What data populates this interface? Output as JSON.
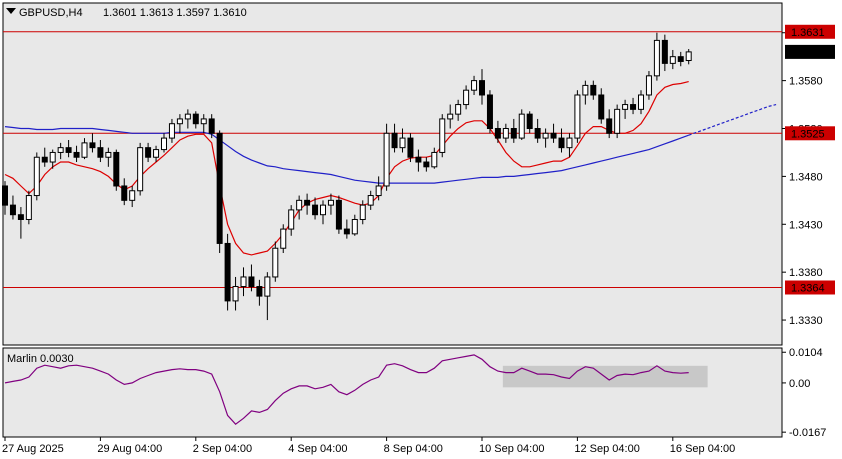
{
  "colors": {
    "panel_bg": "#e8e8e8",
    "axis_bg": "#ffffff",
    "bull_candle": "#ffffff",
    "bear_candle": "#000000",
    "fast_ma": "#dd0000",
    "slow_ma": "#2020c8",
    "level_line": "#cc0000",
    "marlin_line": "#800080",
    "marlin_zone": "#c8c8c8"
  },
  "icons": {
    "collapse": "triangle-down-icon"
  },
  "chart_data": [
    {
      "type": "candlestick",
      "title": "GBPUSD,H4",
      "ohlc_header": "1.3601 1.3613 1.3597 1.3610",
      "ylim": [
        1.3305,
        1.366
      ],
      "y_ticks": [
        "1.3630",
        "1.3580",
        "1.3530",
        "1.3480",
        "1.3430",
        "1.3380",
        "1.3330"
      ],
      "x_ticks": [
        "27 Aug 2025",
        "29 Aug 04:00",
        "2 Sep 04:00",
        "4 Sep 04:00",
        "8 Sep 04:00",
        "10 Sep 04:00",
        "12 Sep 04:00",
        "16 Sep 04:00"
      ],
      "x_tick_positions": [
        0,
        12,
        24,
        36,
        48,
        60,
        72,
        84
      ],
      "price_labels": [
        {
          "text": "1.3631",
          "value": 1.3631,
          "style": "level"
        },
        {
          "text": "1.3610",
          "value": 1.361,
          "style": "current"
        },
        {
          "text": "1.3525",
          "value": 1.3525,
          "style": "level"
        },
        {
          "text": "1.3364",
          "value": 1.3364,
          "style": "level"
        }
      ],
      "levels": [
        1.3631,
        1.3525,
        1.3364
      ],
      "candles": [
        [
          1.347,
          1.3475,
          1.344,
          1.345
        ],
        [
          1.345,
          1.346,
          1.3435,
          1.344
        ],
        [
          1.344,
          1.3448,
          1.3415,
          1.3435
        ],
        [
          1.3435,
          1.3465,
          1.343,
          1.346
        ],
        [
          1.346,
          1.3505,
          1.3455,
          1.35
        ],
        [
          1.35,
          1.351,
          1.349,
          1.3495
        ],
        [
          1.3495,
          1.3508,
          1.3488,
          1.3505
        ],
        [
          1.3505,
          1.3515,
          1.3498,
          1.351
        ],
        [
          1.351,
          1.3518,
          1.35,
          1.3505
        ],
        [
          1.3505,
          1.3512,
          1.3495,
          1.35
        ],
        [
          1.35,
          1.352,
          1.3498,
          1.3515
        ],
        [
          1.3515,
          1.3525,
          1.3505,
          1.351
        ],
        [
          1.351,
          1.3518,
          1.3495,
          1.35
        ],
        [
          1.35,
          1.351,
          1.349,
          1.3505
        ],
        [
          1.3505,
          1.3508,
          1.3465,
          1.347
        ],
        [
          1.347,
          1.3478,
          1.345,
          1.3455
        ],
        [
          1.3455,
          1.347,
          1.3448,
          1.3465
        ],
        [
          1.3465,
          1.3515,
          1.346,
          1.351
        ],
        [
          1.351,
          1.3515,
          1.3495,
          1.35
        ],
        [
          1.35,
          1.3512,
          1.3495,
          1.3508
        ],
        [
          1.3508,
          1.3525,
          1.3505,
          1.352
        ],
        [
          1.352,
          1.354,
          1.3515,
          1.3535
        ],
        [
          1.3535,
          1.3545,
          1.3525,
          1.354
        ],
        [
          1.354,
          1.355,
          1.353,
          1.3545
        ],
        [
          1.3545,
          1.3548,
          1.353,
          1.3535
        ],
        [
          1.3535,
          1.3545,
          1.3525,
          1.354
        ],
        [
          1.354,
          1.3545,
          1.352,
          1.3525
        ],
        [
          1.3525,
          1.3528,
          1.34,
          1.341
        ],
        [
          1.341,
          1.342,
          1.334,
          1.335
        ],
        [
          1.335,
          1.3375,
          1.334,
          1.3365
        ],
        [
          1.3365,
          1.3385,
          1.3355,
          1.3375
        ],
        [
          1.3375,
          1.3388,
          1.336,
          1.3365
        ],
        [
          1.3365,
          1.3372,
          1.3345,
          1.3355
        ],
        [
          1.3355,
          1.338,
          1.333,
          1.3375
        ],
        [
          1.3375,
          1.3412,
          1.337,
          1.3405
        ],
        [
          1.3405,
          1.343,
          1.34,
          1.3425
        ],
        [
          1.3425,
          1.345,
          1.3418,
          1.3445
        ],
        [
          1.3445,
          1.346,
          1.3435,
          1.3455
        ],
        [
          1.3455,
          1.3462,
          1.344,
          1.345
        ],
        [
          1.345,
          1.3458,
          1.3435,
          1.344
        ],
        [
          1.344,
          1.3455,
          1.343,
          1.345
        ],
        [
          1.345,
          1.3462,
          1.344,
          1.3455
        ],
        [
          1.3455,
          1.346,
          1.342,
          1.3425
        ],
        [
          1.3425,
          1.3435,
          1.3415,
          1.342
        ],
        [
          1.342,
          1.344,
          1.3418,
          1.3435
        ],
        [
          1.3435,
          1.3455,
          1.343,
          1.345
        ],
        [
          1.345,
          1.3465,
          1.3445,
          1.346
        ],
        [
          1.346,
          1.348,
          1.3455,
          1.347
        ],
        [
          1.347,
          1.3535,
          1.3465,
          1.3525
        ],
        [
          1.3525,
          1.3535,
          1.3505,
          1.351
        ],
        [
          1.351,
          1.353,
          1.3505,
          1.352
        ],
        [
          1.352,
          1.3525,
          1.3495,
          1.35
        ],
        [
          1.35,
          1.3508,
          1.3485,
          1.3495
        ],
        [
          1.3495,
          1.35,
          1.3485,
          1.349
        ],
        [
          1.349,
          1.351,
          1.3488,
          1.3505
        ],
        [
          1.3505,
          1.3545,
          1.35,
          1.354
        ],
        [
          1.354,
          1.3555,
          1.353,
          1.3545
        ],
        [
          1.3545,
          1.356,
          1.3538,
          1.3555
        ],
        [
          1.3555,
          1.3575,
          1.355,
          1.357
        ],
        [
          1.357,
          1.3585,
          1.3565,
          1.358
        ],
        [
          1.358,
          1.3592,
          1.3555,
          1.3565
        ],
        [
          1.3565,
          1.357,
          1.3525,
          1.353
        ],
        [
          1.353,
          1.3538,
          1.3515,
          1.352
        ],
        [
          1.352,
          1.3535,
          1.3515,
          1.353
        ],
        [
          1.353,
          1.354,
          1.3515,
          1.352
        ],
        [
          1.352,
          1.355,
          1.3518,
          1.3545
        ],
        [
          1.3545,
          1.3548,
          1.3525,
          1.353
        ],
        [
          1.353,
          1.354,
          1.3515,
          1.352
        ],
        [
          1.352,
          1.353,
          1.351,
          1.3525
        ],
        [
          1.3525,
          1.3535,
          1.3515,
          1.352
        ],
        [
          1.352,
          1.353,
          1.3505,
          1.351
        ],
        [
          1.351,
          1.3525,
          1.35,
          1.352
        ],
        [
          1.352,
          1.357,
          1.3515,
          1.3565
        ],
        [
          1.3565,
          1.358,
          1.3555,
          1.3575
        ],
        [
          1.3575,
          1.358,
          1.356,
          1.3565
        ],
        [
          1.3565,
          1.3572,
          1.3535,
          1.354
        ],
        [
          1.354,
          1.355,
          1.352,
          1.3525
        ],
        [
          1.3525,
          1.3555,
          1.352,
          1.355
        ],
        [
          1.355,
          1.356,
          1.354,
          1.3555
        ],
        [
          1.3555,
          1.3562,
          1.3545,
          1.355
        ],
        [
          1.355,
          1.357,
          1.3545,
          1.3565
        ],
        [
          1.3565,
          1.359,
          1.356,
          1.3585
        ],
        [
          1.3585,
          1.363,
          1.358,
          1.3622
        ],
        [
          1.3622,
          1.3628,
          1.359,
          1.3598
        ],
        [
          1.3598,
          1.3612,
          1.3592,
          1.3605
        ],
        [
          1.3605,
          1.361,
          1.3595,
          1.36
        ],
        [
          1.3601,
          1.3613,
          1.3597,
          1.361
        ]
      ],
      "fast_ma": [
        1.3482,
        1.3478,
        1.347,
        1.3462,
        1.347,
        1.3482,
        1.349,
        1.3495,
        1.3495,
        1.3492,
        1.349,
        1.3488,
        1.3485,
        1.348,
        1.3472,
        1.3466,
        1.347,
        1.348,
        1.3488,
        1.3495,
        1.3502,
        1.351,
        1.3518,
        1.3522,
        1.3524,
        1.3524,
        1.3515,
        1.347,
        1.343,
        1.341,
        1.34,
        1.3398,
        1.34,
        1.3402,
        1.341,
        1.342,
        1.3432,
        1.3445,
        1.3452,
        1.3456,
        1.3458,
        1.346,
        1.3458,
        1.3455,
        1.3452,
        1.345,
        1.3452,
        1.346,
        1.3478,
        1.349,
        1.3496,
        1.3499,
        1.35,
        1.35,
        1.3502,
        1.3512,
        1.3522,
        1.353,
        1.3536,
        1.3538,
        1.3538,
        1.353,
        1.3518,
        1.3505,
        1.3496,
        1.349,
        1.349,
        1.3492,
        1.3494,
        1.3496,
        1.3496,
        1.35,
        1.3512,
        1.3525,
        1.3532,
        1.3532,
        1.3528,
        1.3525,
        1.3525,
        1.3528,
        1.3535,
        1.3548,
        1.3565,
        1.3573,
        1.3576,
        1.3577,
        1.3579
      ],
      "slow_ma": [
        1.3532,
        1.3531,
        1.353,
        1.353,
        1.3529,
        1.3529,
        1.3529,
        1.353,
        1.353,
        1.353,
        1.353,
        1.353,
        1.3529,
        1.3528,
        1.3527,
        1.3526,
        1.3525,
        1.3525,
        1.3525,
        1.3525,
        1.3525,
        1.3526,
        1.3526,
        1.3526,
        1.3526,
        1.3526,
        1.3524,
        1.3518,
        1.3512,
        1.3506,
        1.3501,
        1.3497,
        1.3494,
        1.3491,
        1.349,
        1.3488,
        1.3487,
        1.3486,
        1.3485,
        1.3484,
        1.3483,
        1.3482,
        1.348,
        1.3478,
        1.3476,
        1.3475,
        1.3474,
        1.3473,
        1.3473,
        1.3473,
        1.3473,
        1.3473,
        1.3473,
        1.3473,
        1.3473,
        1.3474,
        1.3475,
        1.3476,
        1.3477,
        1.3478,
        1.3479,
        1.3479,
        1.3479,
        1.348,
        1.348,
        1.3481,
        1.3482,
        1.3483,
        1.3484,
        1.3485,
        1.3486,
        1.3488,
        1.349,
        1.3492,
        1.3494,
        1.3496,
        1.3498,
        1.35,
        1.3502,
        1.3504,
        1.3506,
        1.3508,
        1.3511,
        1.3514,
        1.3517,
        1.352,
        1.3523
      ],
      "slow_ma_projection": [
        1.3523,
        1.3526,
        1.3529,
        1.3532,
        1.3535,
        1.3538,
        1.3541,
        1.3544,
        1.3547,
        1.355,
        1.3553,
        1.3555
      ]
    },
    {
      "type": "line",
      "title": "Marlin 0.0030",
      "ylim": [
        -0.018,
        0.0115
      ],
      "y_ticks": [
        "0.0104",
        "0.00",
        "-0.0167"
      ],
      "y_tick_values": [
        0.0104,
        0.0,
        -0.0167
      ],
      "zone": {
        "from_index": 63,
        "to_index": 88,
        "ymin": -0.0015,
        "ymax": 0.0058
      },
      "values": [
        0.0,
        0.0005,
        0.001,
        0.002,
        0.005,
        0.006,
        0.0055,
        0.005,
        0.0058,
        0.006,
        0.0055,
        0.005,
        0.004,
        0.003,
        0.001,
        -0.0005,
        0.0,
        0.0015,
        0.0025,
        0.0035,
        0.004,
        0.0045,
        0.0048,
        0.0045,
        0.0045,
        0.004,
        0.003,
        -0.003,
        -0.011,
        -0.014,
        -0.012,
        -0.0095,
        -0.01,
        -0.009,
        -0.006,
        -0.0035,
        -0.002,
        -0.001,
        -0.001,
        -0.002,
        -0.0015,
        -0.0005,
        -0.003,
        -0.004,
        -0.0025,
        -0.0005,
        0.001,
        0.002,
        0.006,
        0.0065,
        0.0058,
        0.0045,
        0.0035,
        0.0035,
        0.005,
        0.0075,
        0.008,
        0.0085,
        0.009,
        0.0095,
        0.008,
        0.0055,
        0.004,
        0.0035,
        0.0035,
        0.005,
        0.004,
        0.003,
        0.003,
        0.0028,
        0.002,
        0.0015,
        0.004,
        0.0055,
        0.005,
        0.003,
        0.001,
        0.0025,
        0.003,
        0.0028,
        0.0035,
        0.004,
        0.0058,
        0.004,
        0.0035,
        0.0033,
        0.0035
      ]
    }
  ]
}
